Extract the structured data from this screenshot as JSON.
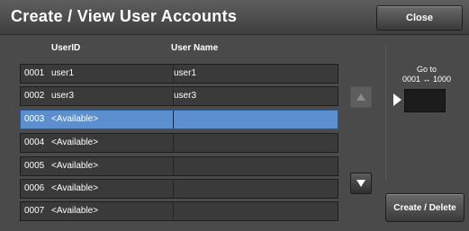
{
  "window": {
    "title": "Create / View User Accounts"
  },
  "toolbar": {
    "close_label": "Close"
  },
  "table": {
    "headers": {
      "userid": "UserID",
      "username": "User Name"
    },
    "rows": [
      {
        "num": "0001",
        "userid": "user1",
        "username": "user1",
        "selected": false
      },
      {
        "num": "0002",
        "userid": "user3",
        "username": "user3",
        "selected": false
      },
      {
        "num": "0003",
        "userid": "<Available>",
        "username": "",
        "selected": true
      },
      {
        "num": "0004",
        "userid": "<Available>",
        "username": "",
        "selected": false
      },
      {
        "num": "0005",
        "userid": "<Available>",
        "username": "",
        "selected": false
      },
      {
        "num": "0006",
        "userid": "<Available>",
        "username": "",
        "selected": false
      },
      {
        "num": "0007",
        "userid": "<Available>",
        "username": "",
        "selected": false
      }
    ]
  },
  "goto": {
    "label_line1": "Go to",
    "label_line2": "0001 ↔ 1000",
    "value": ""
  },
  "actions": {
    "create_delete_label": "Create / Delete"
  },
  "icons": {
    "scroll_up": "triangle-up-icon",
    "scroll_down": "triangle-down-icon",
    "pointer": "triangle-right-icon"
  },
  "colors": {
    "selected_row": "#5b8fd0",
    "background": "#4a4a4a"
  }
}
